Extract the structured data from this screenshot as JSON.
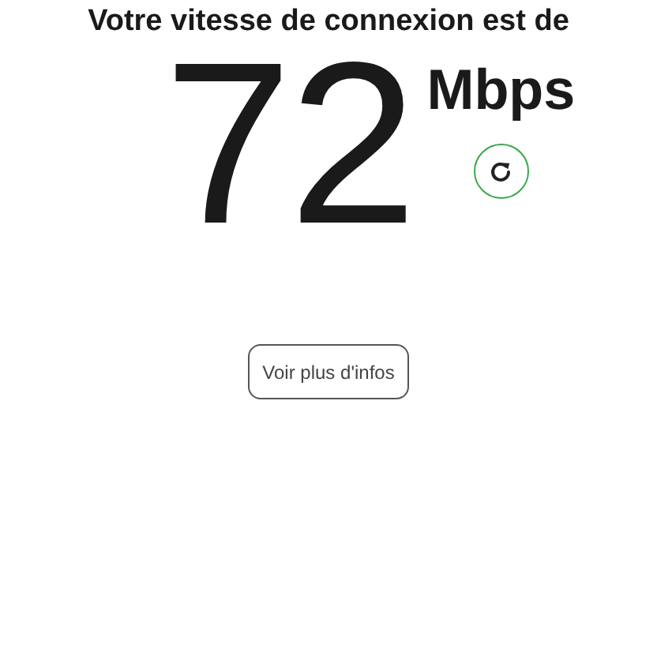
{
  "heading": "Votre vitesse de connexion est de",
  "speed": {
    "value": "72",
    "unit": "Mbps"
  },
  "more_button": {
    "label": "Voir plus d'infos"
  }
}
